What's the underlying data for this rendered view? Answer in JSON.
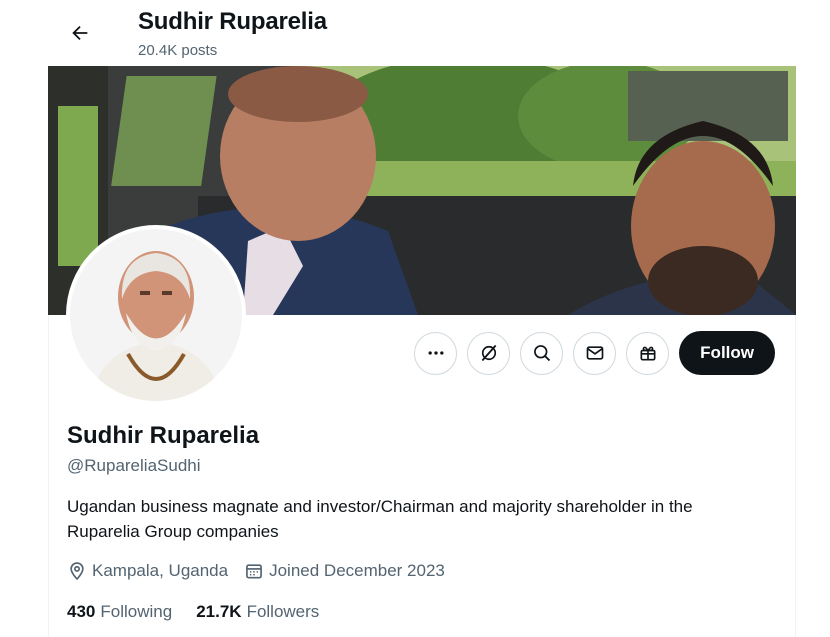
{
  "header": {
    "title": "Sudhir Ruparelia",
    "posts": "20.4K posts"
  },
  "profile": {
    "name": "Sudhir Ruparelia",
    "handle": "@RupareliaSudhi",
    "bio": "Ugandan business magnate and investor/Chairman and majority shareholder in the Ruparelia Group companies",
    "location": "Kampala, Uganda",
    "joined": "Joined December 2023",
    "following_count": "430",
    "following_label": "Following",
    "followers_count": "21.7K",
    "followers_label": "Followers"
  },
  "actions": {
    "follow_label": "Follow",
    "icons": [
      "more-icon",
      "grok-icon",
      "search-icon",
      "message-icon",
      "gift-icon"
    ]
  },
  "colors": {
    "text_primary": "#0f1419",
    "text_secondary": "#536471",
    "border": "#cfd9de",
    "follow_bg": "#0f1419"
  }
}
